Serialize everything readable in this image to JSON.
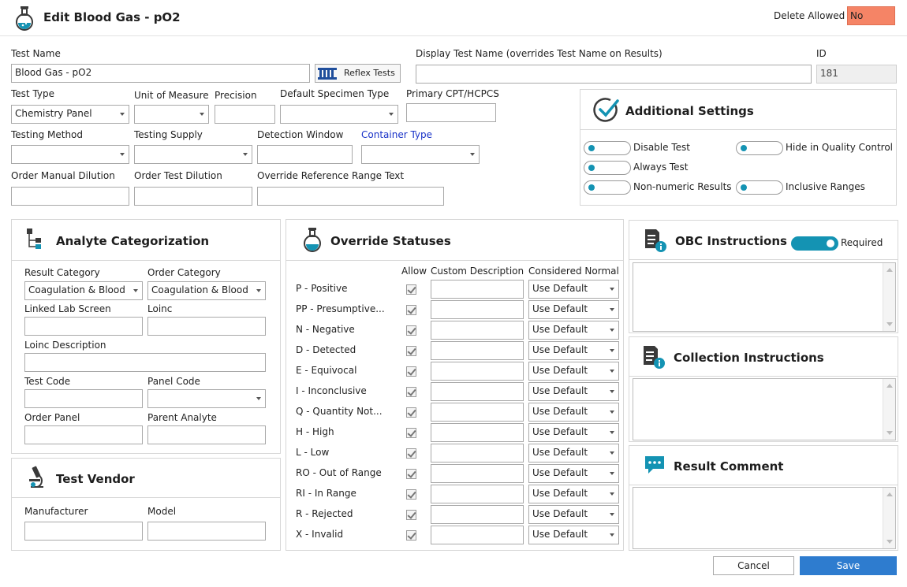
{
  "header": {
    "title": "Edit Blood Gas - pO2",
    "delete_allowed_label": "Delete Allowed",
    "delete_allowed_value": "No"
  },
  "form": {
    "test_name_label": "Test Name",
    "test_name_value": "Blood Gas - pO2",
    "reflex_button": "Reflex Tests",
    "display_name_label": "Display Test Name (overrides Test Name on Results)",
    "display_name_value": "",
    "id_label": "ID",
    "id_value": "181",
    "test_type_label": "Test Type",
    "test_type_value": "Chemistry Panel",
    "unit_label": "Unit of Measure",
    "unit_value": "",
    "precision_label": "Precision",
    "precision_value": "",
    "specimen_label": "Default Specimen Type",
    "specimen_value": "",
    "cpt_label": "Primary CPT/HCPCS",
    "cpt_value": "",
    "method_label": "Testing Method",
    "method_value": "",
    "supply_label": "Testing Supply",
    "supply_value": "",
    "window_label": "Detection Window",
    "window_value": "",
    "container_label": "Container Type",
    "container_value": "",
    "manual_dilution_label": "Order Manual Dilution",
    "manual_dilution_value": "",
    "test_dilution_label": "Order Test Dilution",
    "test_dilution_value": "",
    "override_range_label": "Override Reference Range Text",
    "override_range_value": ""
  },
  "additional": {
    "title": "Additional Settings",
    "disable_test": "Disable Test",
    "hide_qc": "Hide in Quality Control",
    "always_test": "Always Test",
    "non_numeric": "Non-numeric Results",
    "inclusive": "Inclusive Ranges"
  },
  "analyte": {
    "title": "Analyte Categorization",
    "result_category_label": "Result Category",
    "result_category_value": "Coagulation & Blood",
    "order_category_label": "Order Category",
    "order_category_value": "Coagulation & Blood",
    "linked_label": "Linked Lab Screen",
    "linked_value": "",
    "loinc_label": "Loinc",
    "loinc_value": "",
    "loinc_desc_label": "Loinc Description",
    "loinc_desc_value": "",
    "test_code_label": "Test Code",
    "test_code_value": "",
    "panel_code_label": "Panel Code",
    "panel_code_value": "",
    "order_panel_label": "Order Panel",
    "order_panel_value": "",
    "parent_label": "Parent Analyte",
    "parent_value": ""
  },
  "vendor": {
    "title": "Test Vendor",
    "manufacturer_label": "Manufacturer",
    "manufacturer_value": "",
    "model_label": "Model",
    "model_value": ""
  },
  "overrides": {
    "title": "Override Statuses",
    "col_allow": "Allow",
    "col_desc": "Custom Description",
    "col_normal": "Considered Normal",
    "rows": [
      {
        "label": "P - Positive",
        "normal": "Use Default"
      },
      {
        "label": "PP - Presumptive...",
        "normal": "Use Default"
      },
      {
        "label": "N - Negative",
        "normal": "Use Default"
      },
      {
        "label": "D - Detected",
        "normal": "Use Default"
      },
      {
        "label": "E - Equivocal",
        "normal": "Use Default"
      },
      {
        "label": "I - Inconclusive",
        "normal": "Use Default"
      },
      {
        "label": "Q - Quantity Not...",
        "normal": "Use Default"
      },
      {
        "label": "H - High",
        "normal": "Use Default"
      },
      {
        "label": "L - Low",
        "normal": "Use Default"
      },
      {
        "label": "RO - Out of Range",
        "normal": "Use Default"
      },
      {
        "label": "RI - In Range",
        "normal": "Use Default"
      },
      {
        "label": "R - Rejected",
        "normal": "Use Default"
      },
      {
        "label": "X - Invalid",
        "normal": "Use Default"
      }
    ]
  },
  "obc": {
    "title": "OBC Instructions",
    "required_label": "Required"
  },
  "collection": {
    "title": "Collection Instructions"
  },
  "comment": {
    "title": "Result Comment"
  },
  "footer": {
    "cancel": "Cancel",
    "save": "Save"
  },
  "colors": {
    "accent": "#1493b3",
    "save": "#2e7ccf",
    "delete_no": "#f58466",
    "link": "#1a33c8"
  }
}
